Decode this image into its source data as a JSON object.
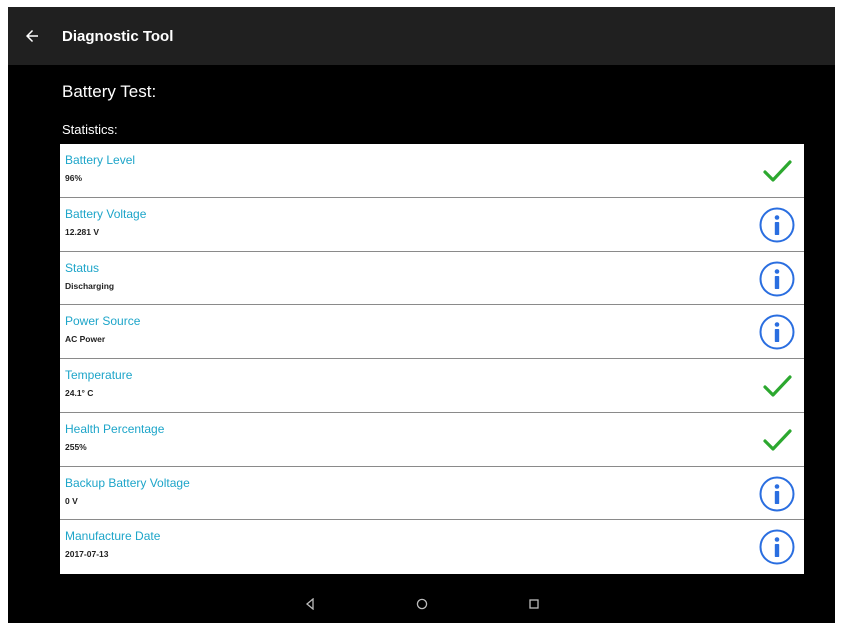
{
  "appbar": {
    "title": "Diagnostic Tool"
  },
  "page": {
    "section_title": "Battery Test:",
    "stats_label": "Statistics:"
  },
  "colors": {
    "accent": "#1da5c9",
    "check": "#2ca82f",
    "info": "#2a6ee0"
  },
  "stats": [
    {
      "name": "Battery Level",
      "value": "96%",
      "icon": "check-icon"
    },
    {
      "name": "Battery Voltage",
      "value": "12.281 V",
      "icon": "info-icon"
    },
    {
      "name": "Status",
      "value": "Discharging",
      "icon": "info-icon"
    },
    {
      "name": "Power Source",
      "value": "AC Power",
      "icon": "info-icon"
    },
    {
      "name": "Temperature",
      "value": "24.1° C",
      "icon": "check-icon"
    },
    {
      "name": "Health Percentage",
      "value": "255%",
      "icon": "check-icon"
    },
    {
      "name": "Backup Battery Voltage",
      "value": "0 V",
      "icon": "info-icon"
    },
    {
      "name": "Manufacture Date",
      "value": "2017-07-13",
      "icon": "info-icon"
    }
  ],
  "navbar": {
    "back": "back-nav-icon",
    "home": "home-nav-icon",
    "recents": "recents-nav-icon"
  }
}
